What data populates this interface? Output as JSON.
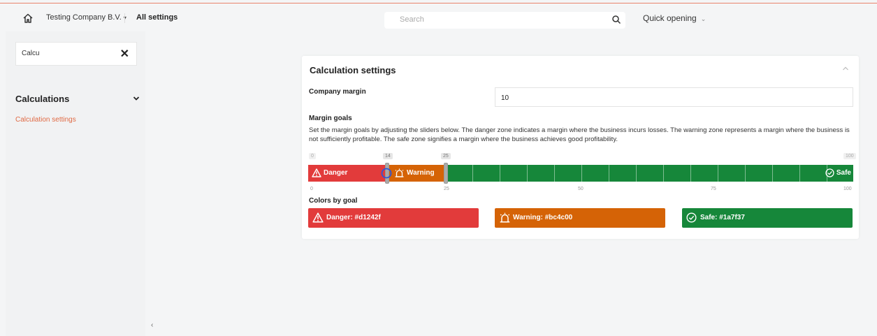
{
  "topbar": {
    "company": "Testing Company B.V.",
    "company_caret": "▾",
    "page": "All settings",
    "search_placeholder": "Search",
    "quick_opening": "Quick opening",
    "quick_chevron": "⌄"
  },
  "sidebar": {
    "filter_value": "Calcu",
    "clear_icon": "✕",
    "section_title": "Calculations",
    "items": [
      {
        "label": "Calculation settings",
        "active": true
      }
    ],
    "collapse_icon": "‹"
  },
  "card": {
    "title": "Calculation settings",
    "company_margin_label": "Company margin",
    "company_margin_value": "10",
    "margin_goals_label": "Margin goals",
    "margin_goals_description": "Set the margin goals by adjusting the sliders below. The danger zone indicates a margin where the business incurs losses. The warning zone represents a margin where the business is not sufficiently profitable. The safe zone signifies a margin where the business achieves good profitability.",
    "slider": {
      "min": 0,
      "max": 100,
      "danger_max": 14,
      "warning_max": 25,
      "min_label": "0",
      "max_label": "100",
      "danger_handle_label": "14",
      "warning_handle_label": "25",
      "scale_labels": [
        "0",
        "25",
        "50",
        "75",
        "100"
      ],
      "danger_label": "Danger",
      "warning_label": "Warning",
      "safe_label": "Safe"
    },
    "colors_by_goal_label": "Colors by goal",
    "colors": {
      "danger": "#d1242f",
      "warning": "#bc4c00",
      "safe": "#1a7f37"
    },
    "color_buttons": [
      {
        "label": "Danger: #d1242f",
        "icon": "warning-triangle-icon",
        "color": "#e23b3b"
      },
      {
        "label": "Warning: #bc4c00",
        "icon": "siren-icon",
        "color": "#d56306"
      },
      {
        "label": "Safe: #1a7f37",
        "icon": "check-circle-icon",
        "color": "#16873a"
      }
    ]
  }
}
